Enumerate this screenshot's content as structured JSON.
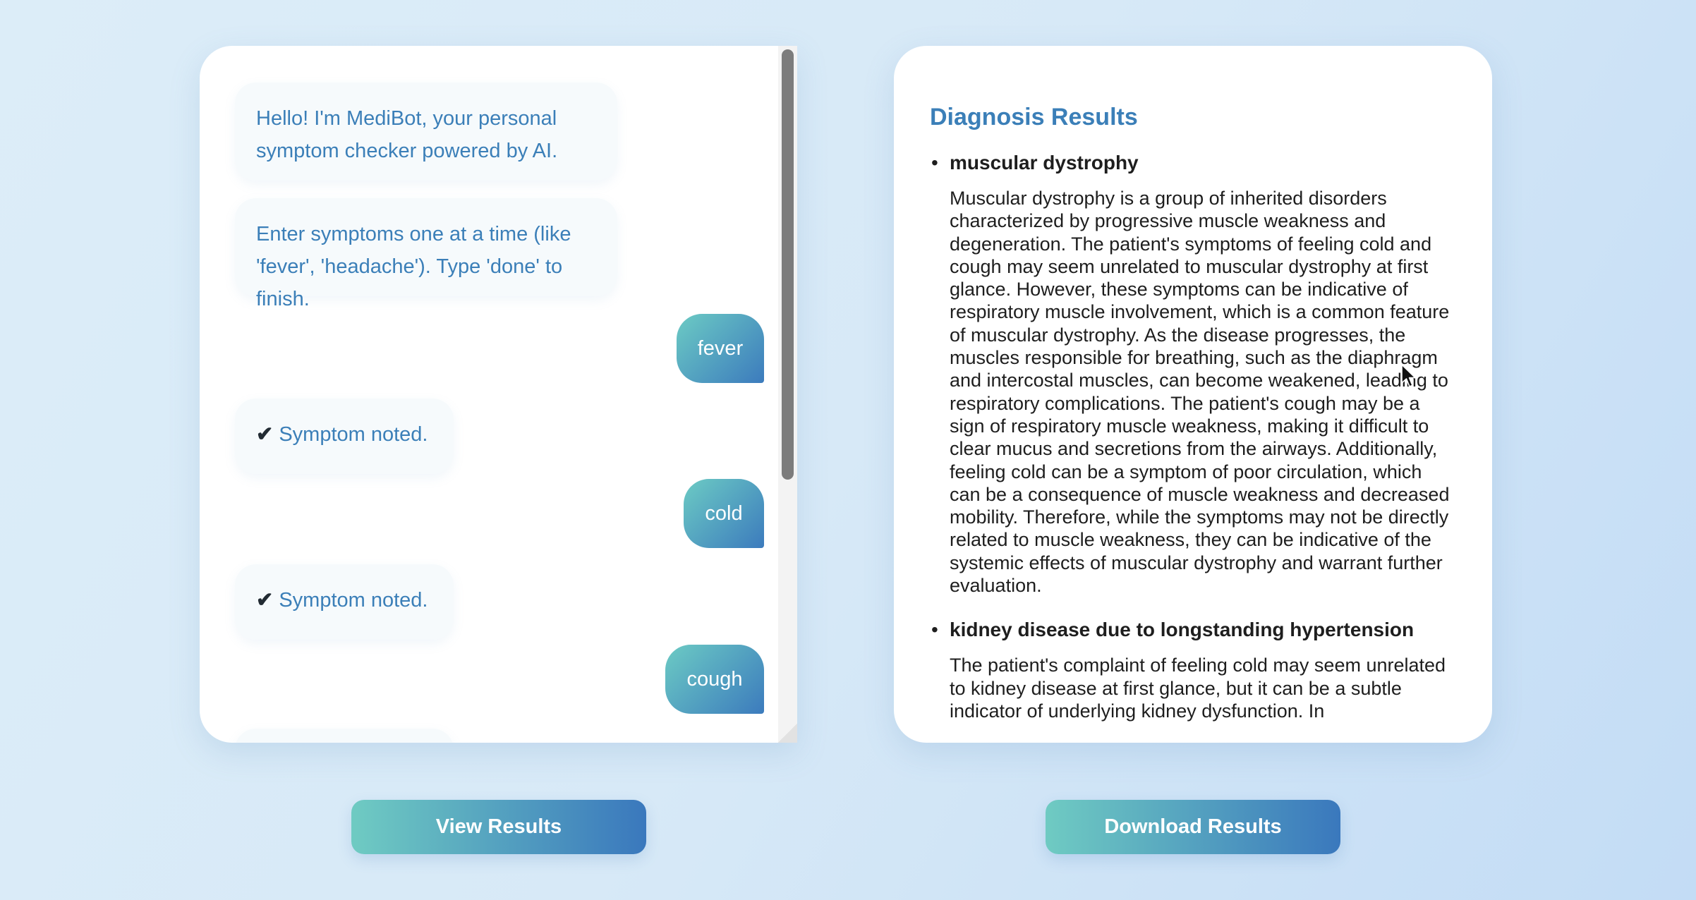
{
  "chat": {
    "messages": [
      {
        "sender": "bot",
        "text": "Hello! I'm MediBot, your personal symptom checker powered by AI."
      },
      {
        "sender": "bot",
        "text": "Enter symptoms one at a time (like 'fever', 'headache'). Type 'done' to finish."
      },
      {
        "sender": "user",
        "text": "fever"
      },
      {
        "sender": "bot",
        "check": "✔",
        "text": "Symptom noted."
      },
      {
        "sender": "user",
        "text": "cold"
      },
      {
        "sender": "bot",
        "check": "✔",
        "text": "Symptom noted."
      },
      {
        "sender": "user",
        "text": "cough"
      }
    ]
  },
  "results": {
    "title": "Diagnosis Results",
    "items": [
      {
        "name": "muscular dystrophy",
        "description": "Muscular dystrophy is a group of inherited disorders characterized by progressive muscle weakness and degeneration. The patient's symptoms of feeling cold and cough may seem unrelated to muscular dystrophy at first glance. However, these symptoms can be indicative of respiratory muscle involvement, which is a common feature of muscular dystrophy. As the disease progresses, the muscles responsible for breathing, such as the diaphragm and intercostal muscles, can become weakened, leading to respiratory complications. The patient's cough may be a sign of respiratory muscle weakness, making it difficult to clear mucus and secretions from the airways. Additionally, feeling cold can be a symptom of poor circulation, which can be a consequence of muscle weakness and decreased mobility. Therefore, while the symptoms may not be directly related to muscle weakness, they can be indicative of the systemic effects of muscular dystrophy and warrant further evaluation."
      },
      {
        "name": "kidney disease due to longstanding hypertension",
        "description": "The patient's complaint of feeling cold may seem unrelated to kidney disease at first glance, but it can be a subtle indicator of underlying kidney dysfunction. In"
      }
    ]
  },
  "buttons": {
    "view_results": "View Results",
    "download_results": "Download Results"
  },
  "colors": {
    "accent": "#3b7fb8",
    "gradient_start": "#6fcbc2",
    "gradient_end": "#3a78bd"
  }
}
